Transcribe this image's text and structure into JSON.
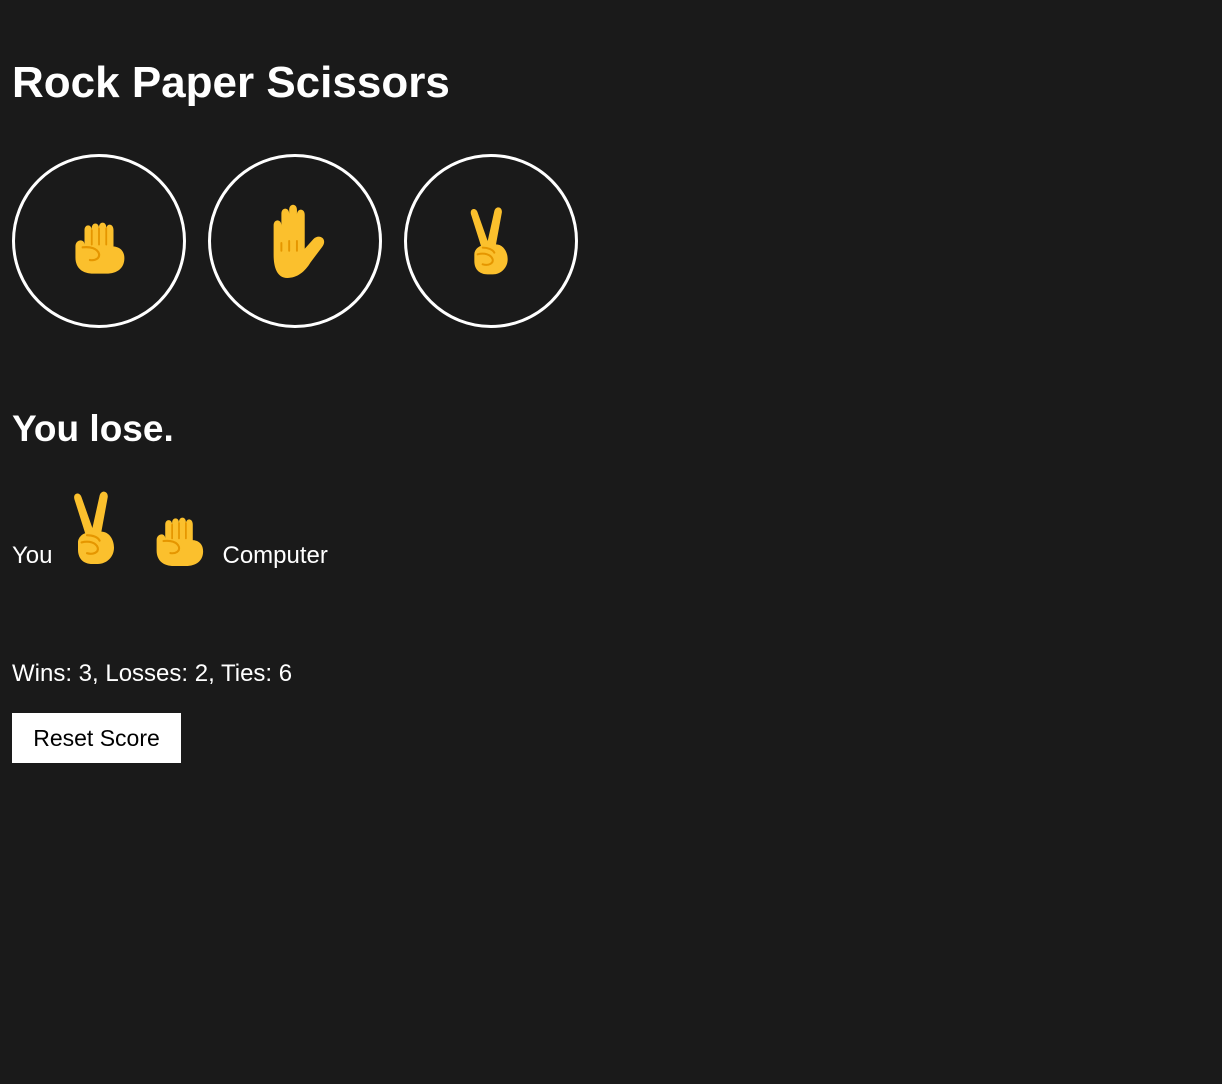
{
  "page": {
    "title": "Rock Paper Scissors"
  },
  "moves": [
    {
      "name": "rock",
      "icon": "fist-icon"
    },
    {
      "name": "paper",
      "icon": "raised-hand-icon"
    },
    {
      "name": "scissors",
      "icon": "victory-hand-icon"
    }
  ],
  "result": {
    "text": "You lose.",
    "player_label": "You",
    "computer_label": "Computer",
    "player_move_icon": "victory-hand-icon",
    "computer_move_icon": "fist-icon"
  },
  "score": {
    "text": "Wins: 3, Losses: 2, Ties: 6",
    "wins": 3,
    "losses": 2,
    "ties": 6
  },
  "reset_button": {
    "label": "Reset Score"
  },
  "colors": {
    "background": "#1a1a1a",
    "text": "#ffffff",
    "emoji_yellow": "#FBC02D",
    "emoji_shade": "#E59600"
  }
}
